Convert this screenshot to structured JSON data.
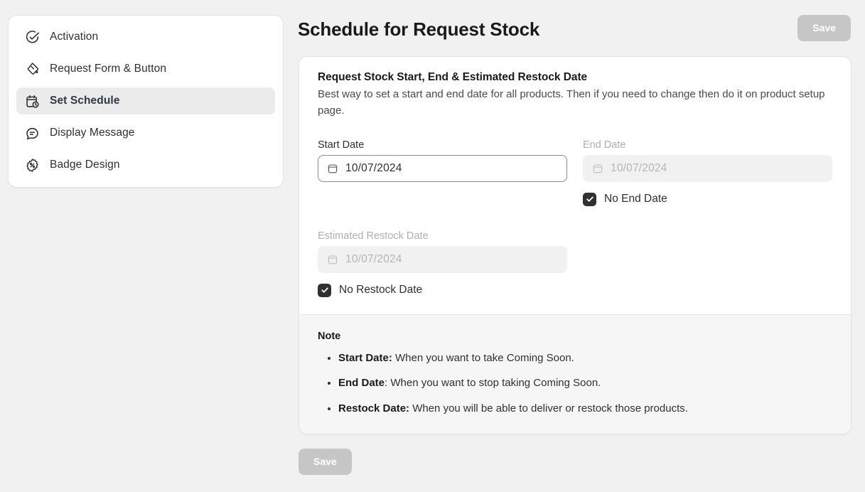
{
  "sidebar": {
    "items": [
      {
        "label": "Activation",
        "icon": "check-circle-icon",
        "active": false
      },
      {
        "label": "Request Form & Button",
        "icon": "paint-bucket-icon",
        "active": false
      },
      {
        "label": "Set Schedule",
        "icon": "calendar-clock-icon",
        "active": true
      },
      {
        "label": "Display Message",
        "icon": "chat-message-icon",
        "active": false
      },
      {
        "label": "Badge Design",
        "icon": "badge-percent-icon",
        "active": false
      }
    ]
  },
  "header": {
    "title": "Schedule for Request Stock",
    "save_label": "Save"
  },
  "card": {
    "title": "Request Stock Start, End & Estimated Restock Date",
    "description": "Best way to set a start and end date for all products. Then if you need to change then do it on product setup page.",
    "fields": {
      "start_date": {
        "label": "Start Date",
        "value": "10/07/2024",
        "placeholder": "10/07/2024",
        "icon": "calendar-icon",
        "disabled": false
      },
      "end_date": {
        "label": "End Date",
        "value": "10/07/2024",
        "placeholder": "10/07/2024",
        "icon": "calendar-icon",
        "disabled": true,
        "checkbox_label": "No End Date",
        "checked": true
      },
      "restock_date": {
        "label": "Estimated Restock Date",
        "value": "10/07/2024",
        "placeholder": "10/07/2024",
        "icon": "calendar-icon",
        "disabled": true,
        "checkbox_label": "No Restock Date",
        "checked": true
      }
    }
  },
  "note": {
    "title": "Note",
    "items": [
      {
        "term": "Start Date:",
        "text": " When you want to take Coming Soon."
      },
      {
        "term": "End Date",
        "text": ": When you want to stop taking Coming Soon."
      },
      {
        "term": "Restock Date:",
        "text": " When you will be able to deliver or restock those products."
      }
    ]
  },
  "footer": {
    "save_label": "Save"
  },
  "colors": {
    "page_background": "#F1F1F1",
    "card_background": "#FFFFFF",
    "note_background": "#F6F6F7",
    "border": "#E3E3E3",
    "text_primary": "#1A1A1A",
    "text_secondary": "#303030",
    "text_muted": "#AFAFAF",
    "checkbox_fill": "#303030",
    "save_disabled": "#C6C6C6",
    "active_nav_background": "#EBEBEB"
  }
}
